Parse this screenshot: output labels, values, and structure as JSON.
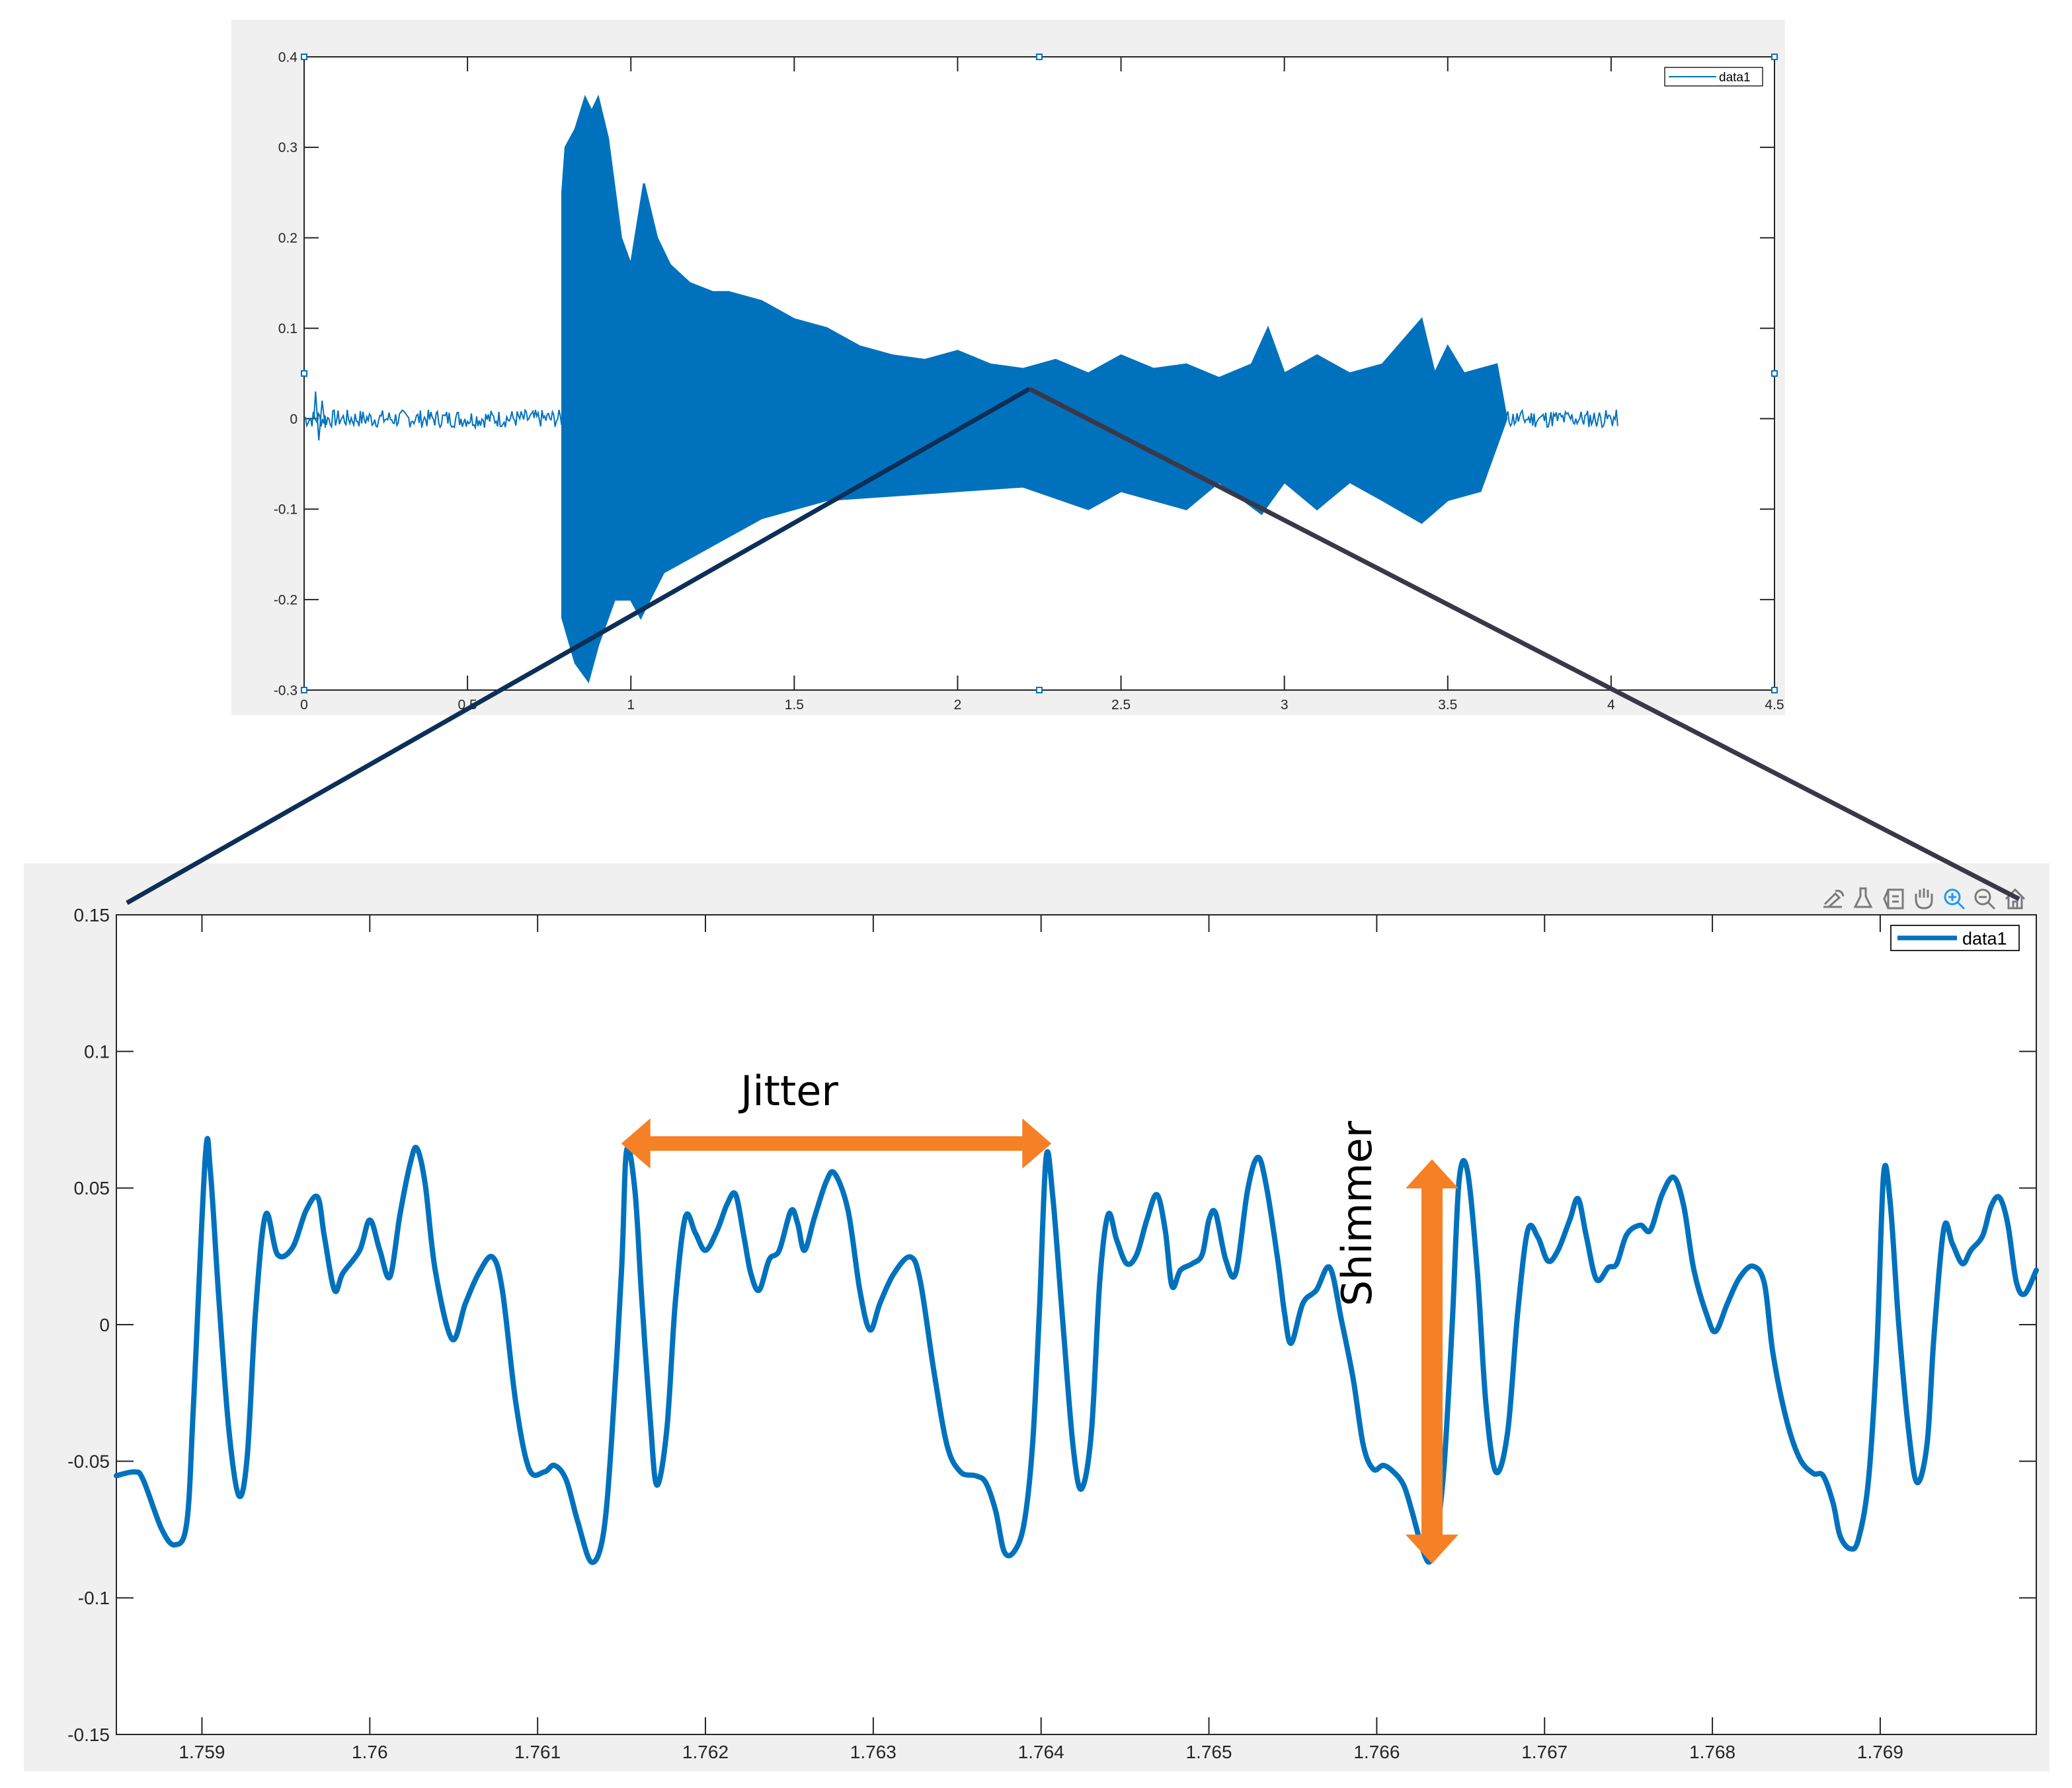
{
  "colors": {
    "line": "#0072bd",
    "annotation": "#f58025",
    "zoom_line_left": "#0d2f57",
    "zoom_line_right": "#3a3848",
    "panel_bg": "#f0f0f0",
    "active_icon": "#1f9bef",
    "icon": "#7a7a7a"
  },
  "toolbar": {
    "icons": [
      "brush-edit-icon",
      "data-brush-icon",
      "legend-toggle-icon",
      "pan-hand-icon",
      "zoom-in-icon",
      "zoom-out-icon",
      "home-restore-icon"
    ],
    "active": "zoom-in-icon"
  },
  "annotations": {
    "jitter": "Jitter",
    "shimmer": "Shimmer"
  },
  "chart_data": [
    {
      "type": "line",
      "title": "",
      "xlabel": "",
      "ylabel": "",
      "xlim": [
        0,
        4.5
      ],
      "ylim": [
        -0.3,
        0.4
      ],
      "xticks": [
        0,
        0.5,
        1,
        1.5,
        2,
        2.5,
        3,
        3.5,
        4,
        4.5
      ],
      "xtick_labels": [
        "0",
        "0.5",
        "1",
        "1.5",
        "2",
        "2.5",
        "3",
        "3.5",
        "4",
        "4.5"
      ],
      "yticks": [
        -0.3,
        -0.2,
        -0.1,
        0,
        0.1,
        0.2,
        0.3,
        0.4
      ],
      "ytick_labels": [
        "-0.3",
        "-0.2",
        "-0.1",
        "0",
        "0.1",
        "0.2",
        "0.3",
        "0.4"
      ],
      "legend": [
        "data1"
      ],
      "legend_position": "top-right",
      "grid": false,
      "signal_extent": [
        0.0,
        4.02
      ],
      "onset_time": 0.79,
      "offset_time": 3.68,
      "envelope_upper": [
        [
          0.79,
          0.25
        ],
        [
          0.8,
          0.3
        ],
        [
          0.83,
          0.32
        ],
        [
          0.86,
          0.355
        ],
        [
          0.88,
          0.34
        ],
        [
          0.9,
          0.355
        ],
        [
          0.93,
          0.31
        ],
        [
          0.97,
          0.2
        ],
        [
          1.0,
          0.17
        ],
        [
          1.04,
          0.26
        ],
        [
          1.08,
          0.2
        ],
        [
          1.12,
          0.17
        ],
        [
          1.18,
          0.15
        ],
        [
          1.25,
          0.14
        ],
        [
          1.3,
          0.14
        ],
        [
          1.4,
          0.13
        ],
        [
          1.5,
          0.11
        ],
        [
          1.6,
          0.1
        ],
        [
          1.7,
          0.08
        ],
        [
          1.8,
          0.07
        ],
        [
          1.9,
          0.065
        ],
        [
          2.0,
          0.075
        ],
        [
          2.1,
          0.06
        ],
        [
          2.2,
          0.055
        ],
        [
          2.3,
          0.065
        ],
        [
          2.4,
          0.05
        ],
        [
          2.5,
          0.07
        ],
        [
          2.6,
          0.055
        ],
        [
          2.7,
          0.06
        ],
        [
          2.8,
          0.045
        ],
        [
          2.9,
          0.06
        ],
        [
          2.95,
          0.1
        ],
        [
          3.0,
          0.05
        ],
        [
          3.1,
          0.07
        ],
        [
          3.2,
          0.05
        ],
        [
          3.3,
          0.06
        ],
        [
          3.42,
          0.11
        ],
        [
          3.46,
          0.05
        ],
        [
          3.5,
          0.08
        ],
        [
          3.55,
          0.05
        ],
        [
          3.65,
          0.06
        ],
        [
          3.68,
          0.0
        ]
      ],
      "envelope_lower": [
        [
          0.79,
          -0.22
        ],
        [
          0.83,
          -0.27
        ],
        [
          0.87,
          -0.29
        ],
        [
          0.9,
          -0.25
        ],
        [
          0.95,
          -0.2
        ],
        [
          1.0,
          -0.2
        ],
        [
          1.03,
          -0.22
        ],
        [
          1.1,
          -0.17
        ],
        [
          1.2,
          -0.15
        ],
        [
          1.3,
          -0.13
        ],
        [
          1.4,
          -0.11
        ],
        [
          1.5,
          -0.1
        ],
        [
          1.6,
          -0.09
        ],
        [
          1.8,
          -0.085
        ],
        [
          2.0,
          -0.08
        ],
        [
          2.2,
          -0.075
        ],
        [
          2.4,
          -0.1
        ],
        [
          2.5,
          -0.08
        ],
        [
          2.7,
          -0.1
        ],
        [
          2.8,
          -0.07
        ],
        [
          2.93,
          -0.105
        ],
        [
          3.0,
          -0.07
        ],
        [
          3.1,
          -0.1
        ],
        [
          3.2,
          -0.07
        ],
        [
          3.3,
          -0.09
        ],
        [
          3.42,
          -0.115
        ],
        [
          3.5,
          -0.09
        ],
        [
          3.6,
          -0.08
        ],
        [
          3.68,
          0.0
        ]
      ],
      "noise_amplitude": 0.01,
      "zoom_anchor": [
        2.22,
        0.033
      ]
    },
    {
      "type": "line",
      "title": "",
      "xlabel": "",
      "ylabel": "",
      "xlim": [
        1.75849,
        1.76993
      ],
      "ylim": [
        -0.15,
        0.15
      ],
      "xticks": [
        1.759,
        1.76,
        1.761,
        1.762,
        1.763,
        1.764,
        1.765,
        1.766,
        1.767,
        1.768,
        1.769
      ],
      "xtick_labels": [
        "1.759",
        "1.76",
        "1.761",
        "1.762",
        "1.763",
        "1.764",
        "1.765",
        "1.766",
        "1.767",
        "1.768",
        "1.769"
      ],
      "yticks": [
        -0.15,
        -0.1,
        -0.05,
        0,
        0.05,
        0.1,
        0.15
      ],
      "ytick_labels": [
        "-0.15",
        "-0.1",
        "-0.05",
        "0",
        "0.05",
        "0.1",
        "0.15"
      ],
      "legend": [
        "data1"
      ],
      "legend_position": "top-right",
      "grid": false,
      "jitter_span": [
        1.76153,
        1.76403
      ],
      "shimmer_span": [
        -0.087,
        0.061
      ],
      "shimmer_x": 1.7663,
      "points": [
        [
          1.75849,
          -0.0553
        ],
        [
          1.7586,
          -0.0539
        ],
        [
          1.75865,
          -0.0568
        ],
        [
          1.75876,
          -0.0748
        ],
        [
          1.75884,
          -0.0806
        ],
        [
          1.75891,
          -0.0723
        ],
        [
          1.75895,
          -0.0286
        ],
        [
          1.75902,
          0.0612
        ],
        [
          1.75905,
          0.0563
        ],
        [
          1.7591,
          0.0102
        ],
        [
          1.75916,
          -0.0383
        ],
        [
          1.75922,
          -0.0626
        ],
        [
          1.75927,
          -0.0481
        ],
        [
          1.75932,
          0.0053
        ],
        [
          1.75938,
          0.0403
        ],
        [
          1.75945,
          0.0257
        ],
        [
          1.75954,
          0.0282
        ],
        [
          1.75962,
          0.0417
        ],
        [
          1.75969,
          0.0466
        ],
        [
          1.75973,
          0.032
        ],
        [
          1.75979,
          0.0126
        ],
        [
          1.75984,
          0.0189
        ],
        [
          1.75994,
          0.0272
        ],
        [
          1.76,
          0.0383
        ],
        [
          1.76006,
          0.0272
        ],
        [
          1.76012,
          0.0175
        ],
        [
          1.76018,
          0.0403
        ],
        [
          1.76024,
          0.0587
        ],
        [
          1.76028,
          0.0646
        ],
        [
          1.76033,
          0.0515
        ],
        [
          1.76039,
          0.0199
        ],
        [
          1.76049,
          -0.0053
        ],
        [
          1.76057,
          0.0078
        ],
        [
          1.76065,
          0.0189
        ],
        [
          1.76073,
          0.0248
        ],
        [
          1.76079,
          0.0126
        ],
        [
          1.76087,
          -0.0286
        ],
        [
          1.76095,
          -0.0529
        ],
        [
          1.76104,
          -0.0539
        ],
        [
          1.7611,
          -0.0515
        ],
        [
          1.76117,
          -0.0568
        ],
        [
          1.76124,
          -0.0723
        ],
        [
          1.76132,
          -0.0869
        ],
        [
          1.76139,
          -0.0772
        ],
        [
          1.76144,
          -0.0432
        ],
        [
          1.7615,
          0.0199
        ],
        [
          1.76153,
          0.0636
        ],
        [
          1.76158,
          0.049
        ],
        [
          1.76162,
          0.0102
        ],
        [
          1.76167,
          -0.0335
        ],
        [
          1.76171,
          -0.0587
        ],
        [
          1.76177,
          -0.0383
        ],
        [
          1.76182,
          0.0078
        ],
        [
          1.76188,
          0.0393
        ],
        [
          1.76194,
          0.0335
        ],
        [
          1.762,
          0.0272
        ],
        [
          1.76207,
          0.0345
        ],
        [
          1.76213,
          0.0442
        ],
        [
          1.76218,
          0.0476
        ],
        [
          1.76223,
          0.032
        ],
        [
          1.76227,
          0.0189
        ],
        [
          1.76232,
          0.0126
        ],
        [
          1.76238,
          0.0238
        ],
        [
          1.76244,
          0.0272
        ],
        [
          1.76251,
          0.0417
        ],
        [
          1.76255,
          0.0369
        ],
        [
          1.76259,
          0.0272
        ],
        [
          1.76265,
          0.0393
        ],
        [
          1.76272,
          0.0524
        ],
        [
          1.76277,
          0.0553
        ],
        [
          1.76285,
          0.0417
        ],
        [
          1.76292,
          0.0126
        ],
        [
          1.76298,
          -0.0019
        ],
        [
          1.76304,
          0.0078
        ],
        [
          1.76312,
          0.0184
        ],
        [
          1.76322,
          0.0248
        ],
        [
          1.76328,
          0.016
        ],
        [
          1.76336,
          -0.0165
        ],
        [
          1.76344,
          -0.0442
        ],
        [
          1.76352,
          -0.0539
        ],
        [
          1.76361,
          -0.0553
        ],
        [
          1.76367,
          -0.0578
        ],
        [
          1.76373,
          -0.0684
        ],
        [
          1.76378,
          -0.083
        ],
        [
          1.76384,
          -0.083
        ],
        [
          1.7639,
          -0.0723
        ],
        [
          1.76395,
          -0.0432
        ],
        [
          1.76399,
          0.0053
        ],
        [
          1.76403,
          0.0612
        ],
        [
          1.76407,
          0.0466
        ],
        [
          1.76413,
          0.0005
        ],
        [
          1.76419,
          -0.0442
        ],
        [
          1.76424,
          -0.0602
        ],
        [
          1.7643,
          -0.0393
        ],
        [
          1.76435,
          0.016
        ],
        [
          1.7644,
          0.0403
        ],
        [
          1.76445,
          0.0311
        ],
        [
          1.76451,
          0.0223
        ],
        [
          1.76457,
          0.0257
        ],
        [
          1.76463,
          0.0383
        ],
        [
          1.76469,
          0.0476
        ],
        [
          1.76474,
          0.0345
        ],
        [
          1.76478,
          0.0141
        ],
        [
          1.76483,
          0.0199
        ],
        [
          1.7649,
          0.0223
        ],
        [
          1.76496,
          0.0257
        ],
        [
          1.765,
          0.0383
        ],
        [
          1.76504,
          0.0408
        ],
        [
          1.7651,
          0.0238
        ],
        [
          1.76516,
          0.0189
        ],
        [
          1.76523,
          0.049
        ],
        [
          1.76529,
          0.0612
        ],
        [
          1.76534,
          0.0515
        ],
        [
          1.76541,
          0.0238
        ],
        [
          1.76545,
          0.0044
        ],
        [
          1.76549,
          -0.0068
        ],
        [
          1.76556,
          0.0078
        ],
        [
          1.76564,
          0.0126
        ],
        [
          1.76572,
          0.0209
        ],
        [
          1.76579,
          0.0015
        ],
        [
          1.76586,
          -0.0199
        ],
        [
          1.76592,
          -0.0442
        ],
        [
          1.76598,
          -0.0529
        ],
        [
          1.76604,
          -0.0515
        ],
        [
          1.7661,
          -0.0539
        ],
        [
          1.76616,
          -0.0587
        ],
        [
          1.76621,
          -0.0684
        ],
        [
          1.76626,
          -0.0796
        ],
        [
          1.76631,
          -0.0869
        ],
        [
          1.76635,
          -0.0796
        ],
        [
          1.7664,
          -0.0529
        ],
        [
          1.76645,
          0.0005
        ],
        [
          1.76649,
          0.0524
        ],
        [
          1.76654,
          0.0563
        ],
        [
          1.7666,
          0.0189
        ],
        [
          1.76665,
          -0.0286
        ],
        [
          1.76671,
          -0.0539
        ],
        [
          1.76678,
          -0.0393
        ],
        [
          1.76684,
          0.0044
        ],
        [
          1.7669,
          0.0345
        ],
        [
          1.76696,
          0.032
        ],
        [
          1.76702,
          0.0233
        ],
        [
          1.76708,
          0.0272
        ],
        [
          1.76715,
          0.0383
        ],
        [
          1.7672,
          0.0461
        ],
        [
          1.76725,
          0.032
        ],
        [
          1.76731,
          0.0165
        ],
        [
          1.76738,
          0.0209
        ],
        [
          1.76743,
          0.0223
        ],
        [
          1.76749,
          0.033
        ],
        [
          1.76757,
          0.0364
        ],
        [
          1.76763,
          0.0345
        ],
        [
          1.7677,
          0.0476
        ],
        [
          1.76777,
          0.0539
        ],
        [
          1.76783,
          0.0432
        ],
        [
          1.76789,
          0.0199
        ],
        [
          1.76797,
          0.0029
        ],
        [
          1.76802,
          -0.0024
        ],
        [
          1.76809,
          0.0078
        ],
        [
          1.76816,
          0.017
        ],
        [
          1.76824,
          0.0214
        ],
        [
          1.76831,
          0.015
        ],
        [
          1.76836,
          -0.0102
        ],
        [
          1.76844,
          -0.0345
        ],
        [
          1.76852,
          -0.049
        ],
        [
          1.7686,
          -0.0544
        ],
        [
          1.76866,
          -0.0553
        ],
        [
          1.76872,
          -0.0655
        ],
        [
          1.76876,
          -0.0772
        ],
        [
          1.76882,
          -0.082
        ],
        [
          1.76887,
          -0.0786
        ],
        [
          1.76893,
          -0.0568
        ],
        [
          1.76898,
          -0.0092
        ],
        [
          1.76902,
          0.0549
        ],
        [
          1.76906,
          0.0442
        ],
        [
          1.76911,
          0.0005
        ],
        [
          1.76917,
          -0.0393
        ],
        [
          1.76922,
          -0.0578
        ],
        [
          1.76928,
          -0.0432
        ],
        [
          1.76932,
          -0.0044
        ],
        [
          1.76938,
          0.0354
        ],
        [
          1.76943,
          0.0296
        ],
        [
          1.76949,
          0.0223
        ],
        [
          1.76954,
          0.0272
        ],
        [
          1.76961,
          0.0325
        ],
        [
          1.76966,
          0.0432
        ],
        [
          1.76971,
          0.0466
        ],
        [
          1.76976,
          0.0369
        ],
        [
          1.76981,
          0.016
        ],
        [
          1.76986,
          0.0112
        ],
        [
          1.76993,
          0.0199
        ]
      ]
    }
  ]
}
